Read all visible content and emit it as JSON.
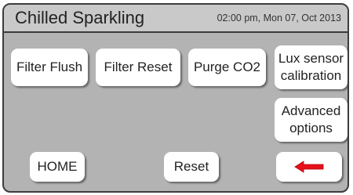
{
  "header": {
    "title": "Chilled Sparkling",
    "datetime": "02:00 pm, Mon 07, Oct 2013"
  },
  "buttons": {
    "filter_flush": "Filter Flush",
    "filter_reset": "Filter Reset",
    "purge_co2": "Purge CO2",
    "lux_sensor_line1": "Lux sensor",
    "lux_sensor_line2": "calibration",
    "advanced_line1": "Advanced",
    "advanced_line2": "options",
    "home": "HOME",
    "reset": "Reset",
    "back_icon": "red-left-arrow-icon"
  },
  "colors": {
    "screen_bg": "#b3b3b3",
    "title_bg": "#c9c9c9",
    "button_bg": "#ffffff",
    "arrow": "#e8101a"
  }
}
